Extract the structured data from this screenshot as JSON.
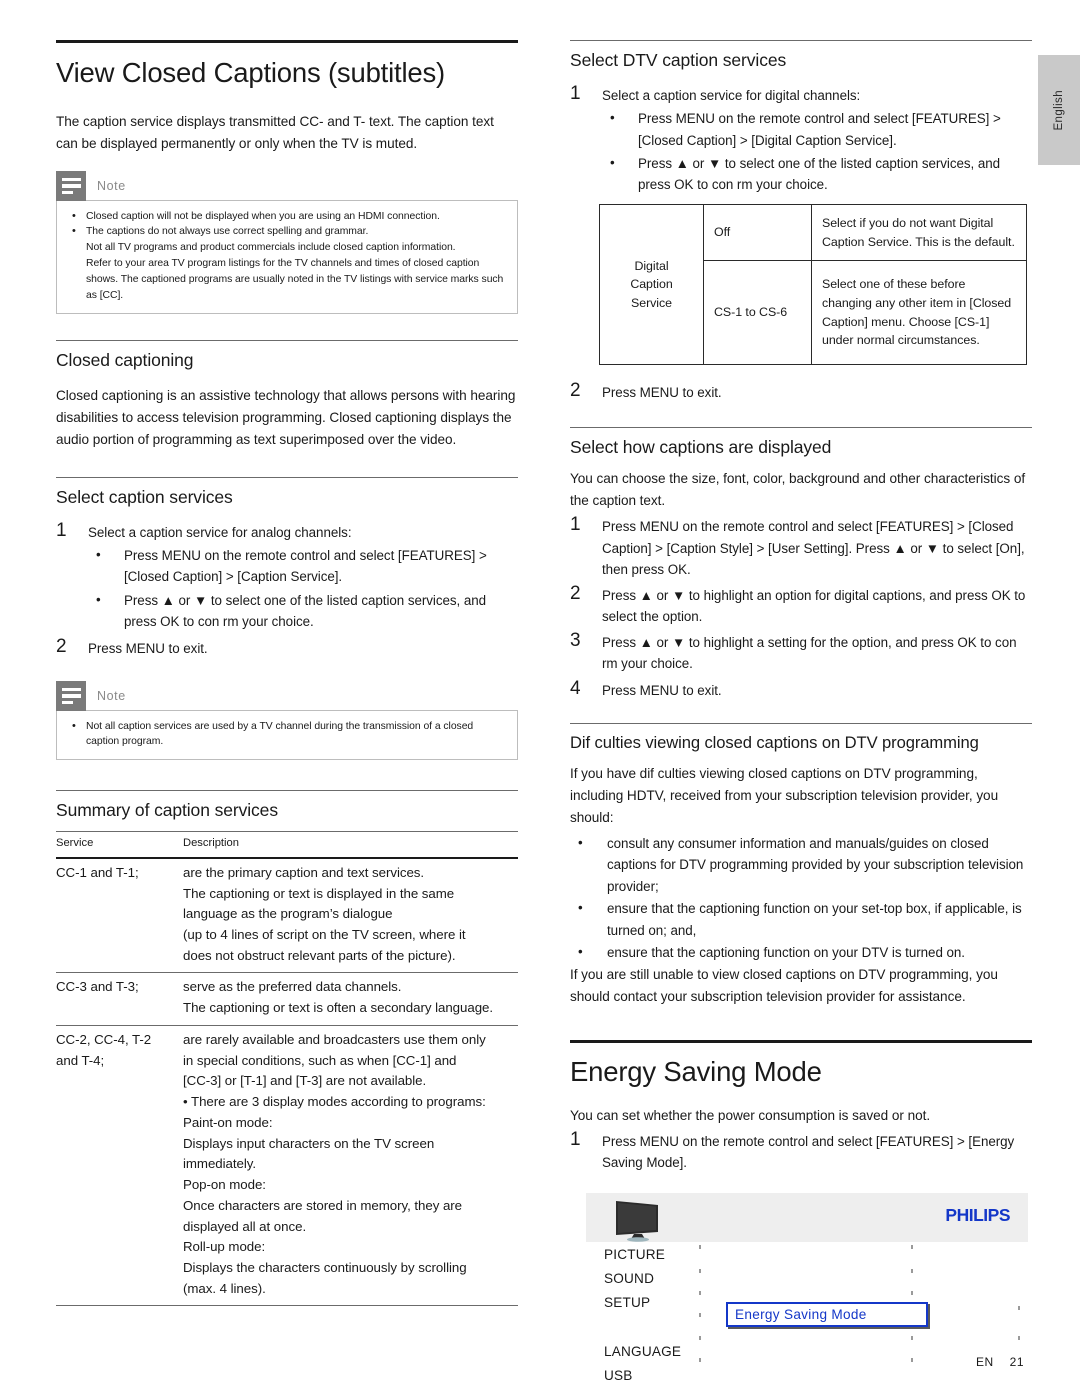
{
  "page": {
    "language_tab": "English",
    "footer_locale": "EN",
    "footer_page": "21"
  },
  "left": {
    "title": "View Closed Captions (subtitles)",
    "intro": "The caption service displays transmitted CC- and T- text. The caption text can be displayed permanently or only when the TV is muted.",
    "note1": {
      "label": "Note",
      "items": [
        "Closed caption will not be displayed when you are using an HDMI connection.",
        "The captions do not always use correct spelling and grammar.",
        "Not all TV programs and product commercials include closed caption information.",
        "Refer to your area TV program listings for the TV channels and times of closed caption shows. The captioned programs are usually noted in the TV listings with service marks such as [CC]."
      ]
    },
    "closed_captioning": {
      "heading": "Closed captioning",
      "body": "Closed captioning is an assistive technology that allows persons with hearing disabilities to access television programming. Closed captioning displays the audio portion of programming as text superimposed over the video."
    },
    "select_caption_services": {
      "heading": "Select caption services",
      "step1_num": "1",
      "step1_text": "Select a caption service for analog channels:",
      "step1_bullets": [
        "Press MENU on the remote control and select [FEATURES] > [Closed Caption] > [Caption Service].",
        "Press ▲ or ▼ to select one of the listed caption services, and press OK to con rm your choice."
      ],
      "step2_num": "2",
      "step2_text": "Press MENU to exit."
    },
    "note2": {
      "label": "Note",
      "items": [
        "Not all caption services are used by a TV channel during the transmission of a closed caption program."
      ]
    },
    "summary": {
      "heading": "Summary of caption services",
      "columns": [
        "Service",
        "Description"
      ],
      "rows": [
        {
          "service": "CC-1 and T-1;",
          "description": [
            "are the primary caption and text services.",
            "The captioning or text is displayed in the same",
            "language as the program’s dialogue",
            "(up to 4 lines of script on the TV screen, where it",
            "does not obstruct relevant parts of the picture)."
          ]
        },
        {
          "service": "CC-3 and T-3;",
          "description": [
            "serve as the preferred data channels.",
            "The captioning or text is often a secondary language."
          ]
        },
        {
          "service": "CC-2, CC-4, T-2 and T-4;",
          "description": [
            "are rarely available and broadcasters use them only",
            "in special conditions, such as when [CC-1] and",
            "[CC-3] or [T-1] and [T-3] are not available.",
            "• There are 3 display modes according to programs:",
            "Paint-on mode:",
            "Displays input characters on the TV screen",
            "immediately.",
            "Pop-on mode:",
            "Once characters are stored in memory, they are",
            "displayed all at once.",
            "Roll-up mode:",
            "Displays the characters continuously by scrolling",
            "(max. 4 lines)."
          ]
        }
      ]
    }
  },
  "right": {
    "select_dtv": {
      "heading": "Select DTV caption services",
      "step1_num": "1",
      "step1_text": "Select a caption service for digital channels:",
      "step1_bullets": [
        "Press MENU on the remote control and select [FEATURES] > [Closed Caption] > [Digital Caption Service].",
        "Press ▲ or ▼ to select one of the listed caption services, and press OK to con rm your choice."
      ],
      "step2_num": "2",
      "step2_text": "Press MENU to exit."
    },
    "dtv_table": {
      "row_label": "Digital Caption Service",
      "rows": [
        {
          "option": "Off",
          "description": "Select if you do not want Digital Caption Service. This is the default."
        },
        {
          "option": "CS-1 to CS-6",
          "description": "Select one of these before changing any other item in [Closed Caption] menu. Choose [CS-1] under normal circumstances."
        }
      ]
    },
    "how_displayed": {
      "heading": "Select how captions are displayed",
      "intro": "You can choose the size, font, color, background and other characteristics of the caption text.",
      "steps": [
        {
          "num": "1",
          "text": "Press MENU on the remote control and select [FEATURES] > [Closed Caption] > [Caption Style] > [User Setting]. Press ▲ or ▼ to select [On], then press OK."
        },
        {
          "num": "2",
          "text": "Press ▲ or ▼ to highlight an option for digital captions, and press OK to select the option."
        },
        {
          "num": "3",
          "text": "Press ▲ or ▼ to highlight a setting for the option, and press OK to con rm your choice."
        },
        {
          "num": "4",
          "text": "Press MENU to exit."
        }
      ]
    },
    "difficulties": {
      "heading": "Dif culties viewing closed captions on DTV programming",
      "intro": "If you have dif culties viewing closed captions on DTV programming, including HDTV, received from your subscription television provider, you should:",
      "bullets": [
        "consult any consumer information and manuals/guides on closed captions for DTV programming provided by your subscription television provider;",
        "ensure that the captioning function on your set-top box, if applicable, is turned on; and,",
        "ensure that the captioning function on your DTV is turned on."
      ],
      "outro": "If you are still unable to view closed captions on DTV programming, you should contact your subscription television provider for assistance."
    },
    "energy": {
      "heading": "Energy Saving Mode",
      "intro": "You can set whether the power consumption is saved or not.",
      "step1_num": "1",
      "step1_text": "Press MENU on the remote control and select [FEATURES] > [Energy Saving Mode].",
      "menu_graphic": {
        "brand": "PHILIPS",
        "items": [
          "PICTURE",
          "SOUND",
          "SETUP",
          "LANGUAGE",
          "USB"
        ],
        "highlighted_option": "Energy Saving Mode",
        "highlight_color": "#1437c8"
      }
    }
  }
}
